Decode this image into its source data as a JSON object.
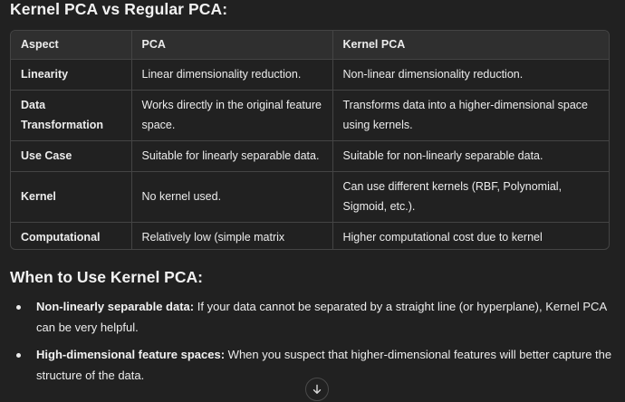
{
  "heading": "Kernel PCA vs Regular PCA:",
  "table": {
    "headers": [
      "Aspect",
      "PCA",
      "Kernel PCA"
    ],
    "rows": [
      {
        "aspect": "Linearity",
        "pca": "Linear dimensionality reduction.",
        "kpca": "Non-linear dimensionality reduction."
      },
      {
        "aspect": "Data Transformation",
        "pca": "Works directly in the original feature space.",
        "kpca": "Transforms data into a higher-dimensional space using kernels."
      },
      {
        "aspect": "Use Case",
        "pca": "Suitable for linearly separable data.",
        "kpca": "Suitable for non-linearly separable data."
      },
      {
        "aspect": "Kernel",
        "pca": "No kernel used.",
        "kpca": "Can use different kernels (RBF, Polynomial, Sigmoid, etc.)."
      },
      {
        "aspect": "Computational Cost",
        "pca": "Relatively low (simple matrix operations).",
        "kpca": "Higher computational cost due to kernel calculations."
      }
    ]
  },
  "section2": {
    "heading": "When to Use Kernel PCA:",
    "bullets": [
      {
        "title": "Non-linearly separable data:",
        "text": " If your data cannot be separated by a straight line (or hyperplane), Kernel PCA can be very helpful."
      },
      {
        "title": "High-dimensional feature spaces:",
        "text": " When you suspect that higher-dimensional features will better capture the structure of the data."
      }
    ]
  },
  "scroll_button": {
    "icon": "arrow-down-icon"
  }
}
